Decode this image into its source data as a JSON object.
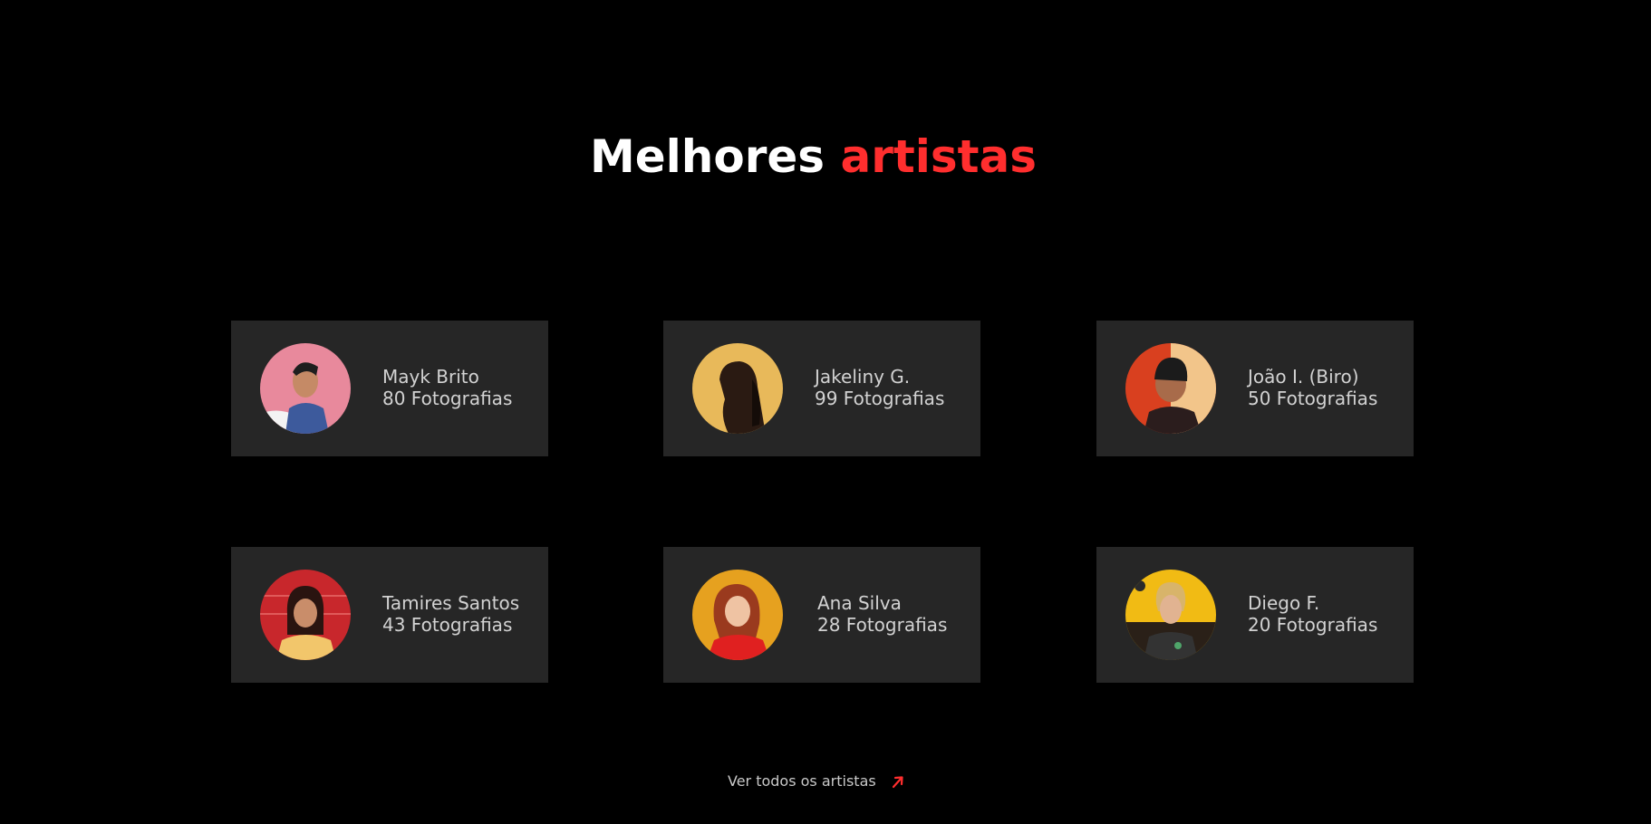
{
  "section": {
    "title_part1": "Melhores",
    "title_part2": "artistas",
    "accent_color": "#ff2e2e"
  },
  "artists": [
    {
      "name": "Mayk Brito",
      "photos": "80 Fotografias",
      "avatar_bg": "#e8899c"
    },
    {
      "name": "Jakeliny G.",
      "photos": "99 Fotografias",
      "avatar_bg": "#e8b95a"
    },
    {
      "name": "João I. (Biro)",
      "photos": "50 Fotografias",
      "avatar_bg": "#d9401f"
    },
    {
      "name": "Tamires Santos",
      "photos": "43 Fotografias",
      "avatar_bg": "#c8272c"
    },
    {
      "name": "Ana Silva",
      "photos": "28 Fotografias",
      "avatar_bg": "#e6a11f"
    },
    {
      "name": "Diego F.",
      "photos": "20 Fotografias",
      "avatar_bg": "#f1bb14"
    }
  ],
  "footer": {
    "view_all_label": "Ver todos os artistas",
    "arrow_icon": "arrow-up-right-icon"
  }
}
